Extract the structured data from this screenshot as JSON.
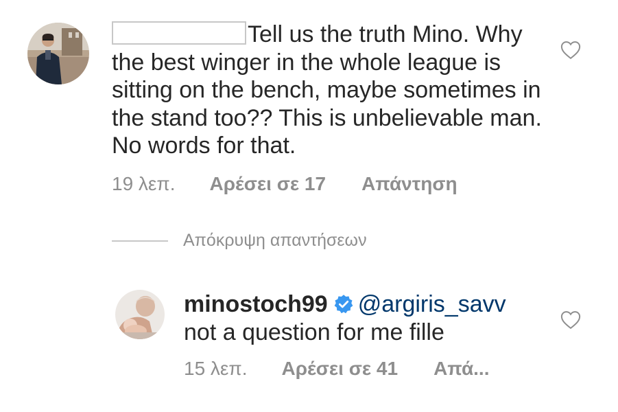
{
  "comment": {
    "text": "Tell us the truth Mino. Why the best winger in the whole league is sitting on the bench, maybe sometimes in the stand too?? This is unbelievable man. No words for that.",
    "time": "19 λεπ.",
    "likes": "Αρέσει σε 17",
    "reply_label": "Απάντηση"
  },
  "hide_replies_label": "Απόκρυψη απαντήσεων",
  "reply": {
    "username": "minostoch99",
    "mention": "@argiris_savv",
    "text": "not a question for me fille",
    "time": "15 λεπ.",
    "likes": "Αρέσει σε 41",
    "reply_label": "Απά..."
  },
  "icons": {
    "like": "heart-outline-icon",
    "verified": "verified-badge-icon"
  },
  "colors": {
    "text": "#262626",
    "secondary": "#8e8e8e",
    "mention": "#00376b",
    "verified": "#3897f0"
  }
}
